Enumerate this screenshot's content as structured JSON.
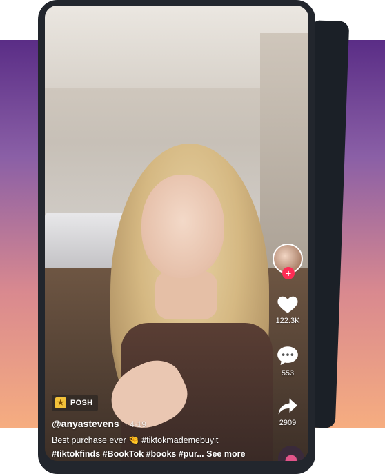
{
  "video": {
    "badge_label": "POSH",
    "badge_icon": "tag-icon",
    "username": "@anyastevens",
    "date": "4-19",
    "caption_line1": "Best purchase ever 🤏 #tiktokmademebuyit",
    "caption_line2": "#tiktokfinds #BookTok #books #pur...",
    "see_more": "See more"
  },
  "actions": {
    "follow_icon": "plus-icon",
    "like_count": "122.3K",
    "comment_count": "553",
    "share_count": "2909"
  },
  "colors": {
    "accent": "#fe2c55",
    "badge": "#f3c23a"
  }
}
